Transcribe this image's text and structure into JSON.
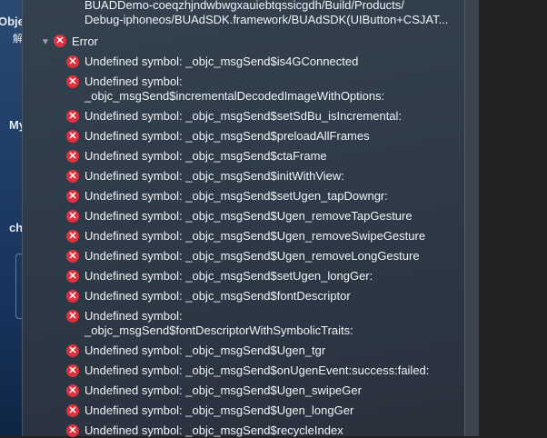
{
  "desktop": {
    "labels": [
      "Obje",
      "解",
      "My",
      "ch"
    ]
  },
  "path_lines": [
    "BUADDemo-coeqzhjndwbwgxauiebtqssicgdh/Build/Products/",
    "Debug-iphoneos/BUAdSDK.framework/BUAdSDK(UIButton+CSJAT..."
  ],
  "group": {
    "label": "Error",
    "icon": "error-icon",
    "expanded": true
  },
  "errors": [
    [
      "Undefined symbol: _objc_msgSend$is4GConnected"
    ],
    [
      "Undefined symbol:",
      "_objc_msgSend$incrementalDecodedImageWithOptions:"
    ],
    [
      "Undefined symbol: _objc_msgSend$setSdBu_isIncremental:"
    ],
    [
      "Undefined symbol: _objc_msgSend$preloadAllFrames"
    ],
    [
      "Undefined symbol: _objc_msgSend$ctaFrame"
    ],
    [
      "Undefined symbol: _objc_msgSend$initWithView:"
    ],
    [
      "Undefined symbol: _objc_msgSend$setUgen_tapDowngr:"
    ],
    [
      "Undefined symbol: _objc_msgSend$Ugen_removeTapGesture"
    ],
    [
      "Undefined symbol: _objc_msgSend$Ugen_removeSwipeGesture"
    ],
    [
      "Undefined symbol: _objc_msgSend$Ugen_removeLongGesture"
    ],
    [
      "Undefined symbol: _objc_msgSend$setUgen_longGer:"
    ],
    [
      "Undefined symbol: _objc_msgSend$fontDescriptor"
    ],
    [
      "Undefined symbol:",
      "_objc_msgSend$fontDescriptorWithSymbolicTraits:"
    ],
    [
      "Undefined symbol: _objc_msgSend$Ugen_tgr"
    ],
    [
      "Undefined symbol: _objc_msgSend$onUgenEvent:success:failed:"
    ],
    [
      "Undefined symbol: _objc_msgSend$Ugen_swipeGer"
    ],
    [
      "Undefined symbol: _objc_msgSend$Ugen_longGer"
    ],
    [
      "Undefined symbol: _objc_msgSend$recycleIndex"
    ]
  ],
  "colors": {
    "error": "#e0303e",
    "panel": "#2f3a47",
    "text": "#f2f4f7"
  }
}
